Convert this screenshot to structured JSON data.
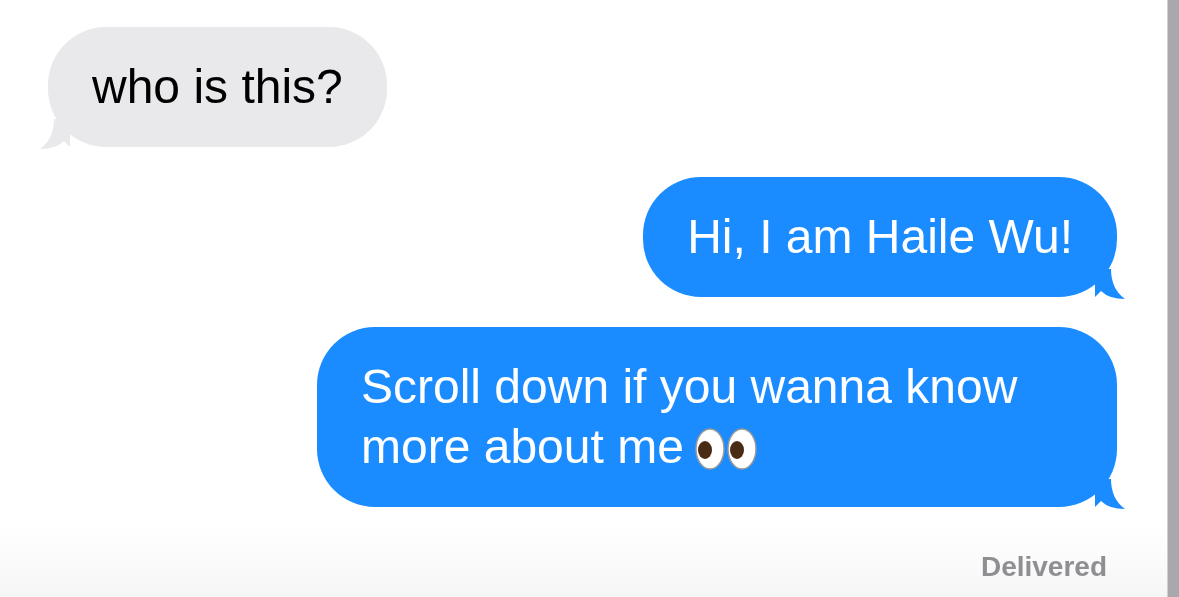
{
  "messages": [
    {
      "kind": "received",
      "text": "who is this?",
      "trailing_icon": false
    },
    {
      "kind": "sent",
      "text": "Hi, I am Haile Wu!",
      "trailing_icon": false
    },
    {
      "kind": "sent",
      "text": "Scroll down if you wanna know more about me",
      "trailing_icon": true
    }
  ],
  "status": "Delivered"
}
